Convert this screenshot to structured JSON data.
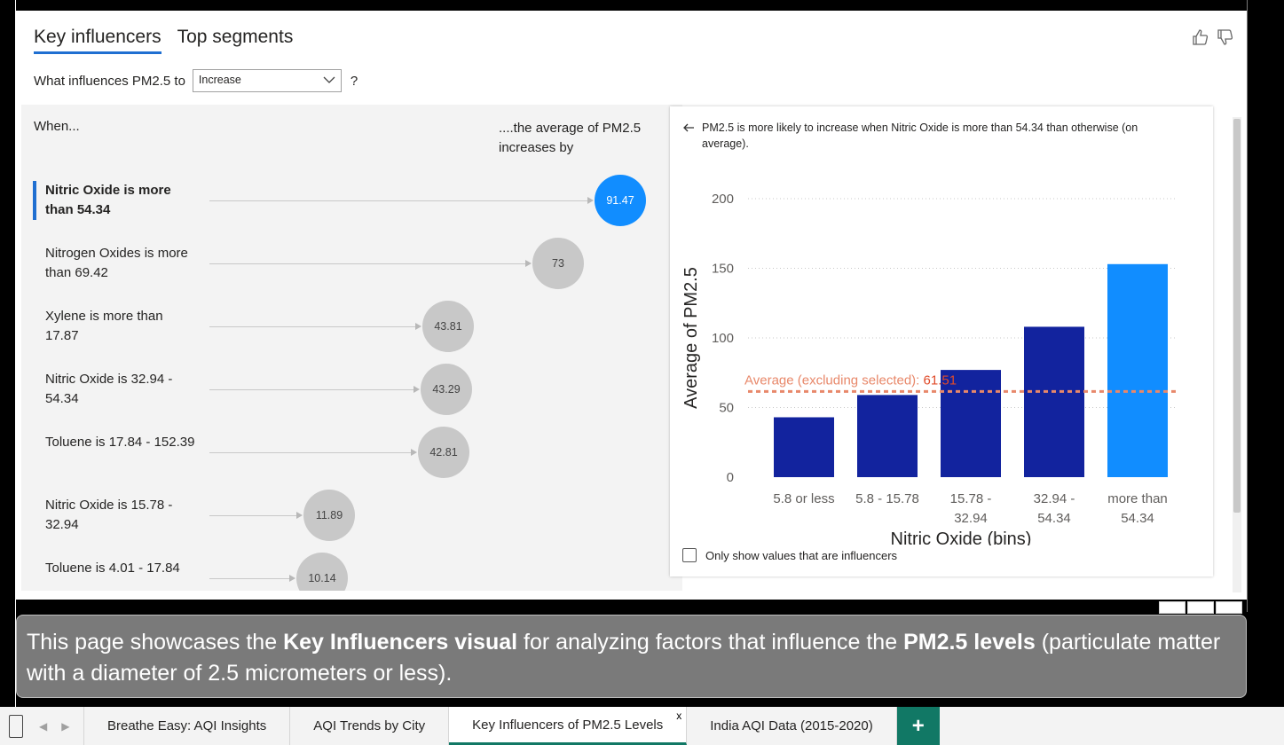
{
  "tabs": [
    {
      "label": "Key influencers",
      "active": true
    },
    {
      "label": "Top segments",
      "active": false
    }
  ],
  "question": {
    "prefix": "What influences PM2.5 to",
    "selected": "Increase",
    "suffix": "?"
  },
  "left": {
    "when_label": "When...",
    "avg_label": "....the average of PM2.5 increases by",
    "influencers": [
      {
        "label": "Nitric Oxide is more than 54.34",
        "value": "91.47",
        "selected": true
      },
      {
        "label": "Nitrogen Oxides is more than 69.42",
        "value": "73",
        "selected": false
      },
      {
        "label": "Xylene is more than 17.87",
        "value": "43.81",
        "selected": false
      },
      {
        "label": "Nitric Oxide is 32.94 - 54.34",
        "value": "43.29",
        "selected": false
      },
      {
        "label": "Toluene is 17.84 - 152.39",
        "value": "42.81",
        "selected": false
      },
      {
        "label": "Nitric Oxide is 15.78 - 32.94",
        "value": "11.89",
        "selected": false
      },
      {
        "label": "Toluene is 4.01 - 17.84",
        "value": "10.14",
        "selected": false
      }
    ]
  },
  "right": {
    "explanation": "PM2.5 is more likely to increase when Nitric Oxide is more than 54.34 than otherwise (on average).",
    "checkbox_label": "Only show values that are influencers",
    "average_label": "Average (excluding selected):",
    "average_value": "61.51"
  },
  "chart_data": {
    "type": "bar",
    "categories": [
      "5.8 or less",
      "5.8 - 15.78",
      "15.78 - 32.94",
      "32.94 - 54.34",
      "more than 54.34"
    ],
    "values": [
      43,
      59,
      77,
      108,
      153
    ],
    "highlight_index": 4,
    "reference_line": 61.51,
    "xlabel": "Nitric Oxide (bins)",
    "ylabel": "Average of PM2.5",
    "ylim": [
      0,
      200
    ],
    "yticks": [
      0,
      50,
      100,
      150,
      200
    ],
    "colors": {
      "bar": "#12239e",
      "highlight": "#118dff",
      "reference": "#e8886a"
    },
    "grid": true
  },
  "caption": {
    "p1": "This page showcases the ",
    "b1": "Key Influencers visual",
    "p2": " for analyzing factors that influence the ",
    "b2": "PM2.5 levels",
    "p3": " (particulate matter with a diameter of 2.5 micrometers or less)."
  },
  "page_tabs": [
    {
      "label": "Breathe Easy: AQI Insights",
      "active": false
    },
    {
      "label": "AQI Trends by City",
      "active": false
    },
    {
      "label": "Key Influencers of PM2.5 Levels",
      "active": true,
      "close": "x"
    },
    {
      "label": "India AQI Data (2015-2020)",
      "active": false
    }
  ],
  "add_tab": "+",
  "colors": {
    "accent": "#118dff",
    "teal": "#117865"
  }
}
